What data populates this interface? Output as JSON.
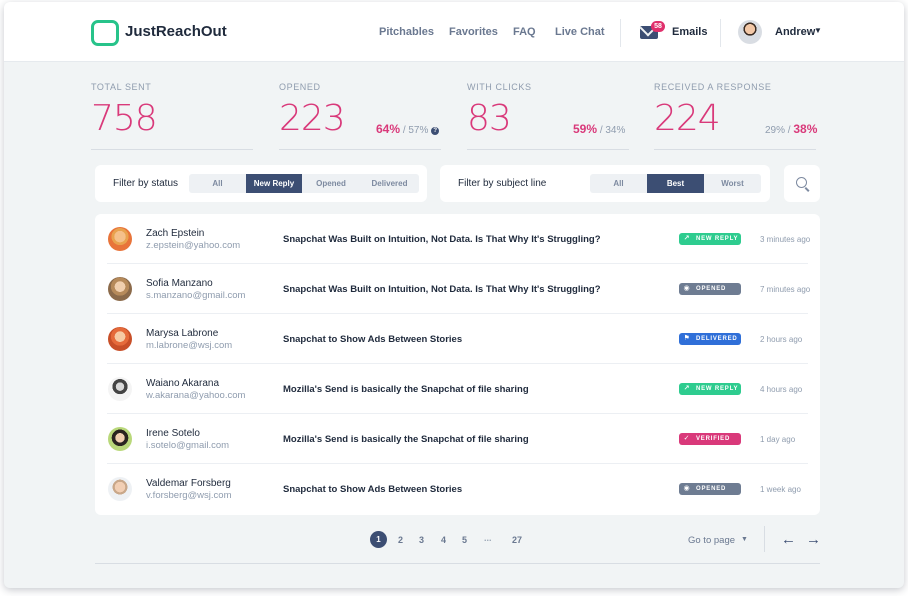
{
  "app": {
    "name": "JustReachOut",
    "accent": "#27c38a",
    "brand_pink": "#d9397a",
    "brand_navy": "#3c4e73"
  },
  "header": {
    "nav": [
      "Pitchables",
      "Favorites",
      "FAQ",
      "Live Chat"
    ],
    "emails_badge": "58",
    "emails_label": "Emails",
    "user_name": "Andrew"
  },
  "stats": {
    "total_sent": {
      "label": "TOTAL SENT",
      "value": "758"
    },
    "opened": {
      "label": "OPENED",
      "value": "223",
      "pct": "64%",
      "rest": "/ 57%"
    },
    "with_clicks": {
      "label": "WITH CLICKS",
      "value": "83",
      "pct": "59%",
      "rest": "/ 34%"
    },
    "response": {
      "label": "RECEIVED A RESPONSE",
      "value": "224",
      "rest": "29% /",
      "pct": "38%"
    }
  },
  "filters": {
    "status_label": "Filter by status",
    "status_options": [
      "All",
      "New Reply",
      "Opened",
      "Delivered"
    ],
    "status_selected": "New Reply",
    "subject_label": "Filter by subject line",
    "subject_options": [
      "All",
      "Best",
      "Worst"
    ],
    "subject_selected": "Best"
  },
  "rows": [
    {
      "name": "Zach Epstein",
      "email": "z.epstein@yahoo.com",
      "subject": "Snapchat Was Built on Intuition, Not Data. Is That Why It's Struggling?",
      "status": "NEW REPLY",
      "status_color": "#2ecc8f",
      "time": "3 minutes ago"
    },
    {
      "name": "Sofia Manzano",
      "email": "s.manzano@gmail.com",
      "subject": "Snapchat Was Built on Intuition, Not Data. Is That Why It's Struggling?",
      "status": "OPENED",
      "status_color": "#6e7c92",
      "time": "7 minutes ago"
    },
    {
      "name": "Marysa Labrone",
      "email": "m.labrone@wsj.com",
      "subject": "Snapchat to Show Ads Between Stories",
      "status": "DELIVERED",
      "status_color": "#2f6fd8",
      "time": "2 hours ago"
    },
    {
      "name": "Waiano Akarana",
      "email": "w.akarana@yahoo.com",
      "subject": "Mozilla's Send is basically the Snapchat of file sharing",
      "status": "NEW REPLY",
      "status_color": "#2ecc8f",
      "time": "4 hours ago"
    },
    {
      "name": "Irene Sotelo",
      "email": "i.sotelo@gmail.com",
      "subject": "Mozilla's Send is basically the Snapchat of file sharing",
      "status": "VERIFIED",
      "status_color": "#d9397a",
      "time": "1 day ago"
    },
    {
      "name": "Valdemar Forsberg",
      "email": "v.forsberg@wsj.com",
      "subject": "Snapchat to Show Ads Between Stories",
      "status": "OPENED",
      "status_color": "#6e7c92",
      "time": "1 week ago"
    }
  ],
  "pagination": {
    "current": "1",
    "pages": [
      "2",
      "3",
      "4",
      "5"
    ],
    "ellipsis": "...",
    "last": "27",
    "goto_label": "Go to page"
  }
}
